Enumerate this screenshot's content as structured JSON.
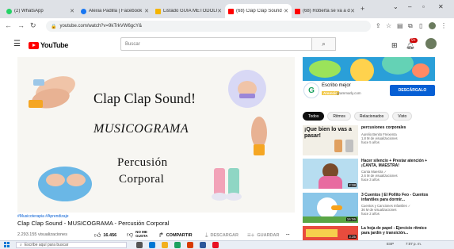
{
  "browser": {
    "tabs": [
      {
        "label": "(2) WhatsApp",
        "color": "#25d366",
        "active": false
      },
      {
        "label": "Alexia Padilla | Facebook",
        "color": "#1877f2",
        "active": false
      },
      {
        "label": "Listado GUIA METODOLÓ...",
        "color": "#f4b400",
        "active": false
      },
      {
        "label": "(68) Clap Clap Sound - Mú...",
        "color": "#ff0000",
        "active": true
      },
      {
        "label": "(68) Roberta se va a dorm...",
        "color": "#ff0000",
        "active": false
      }
    ],
    "new_tab": "+",
    "url": "youtube.com/watch?v=9kTrkVW6gcY&"
  },
  "youtube": {
    "logo_text": "YouTube",
    "search_placeholder": "Buscar",
    "notification_count": "9+"
  },
  "video": {
    "slide": {
      "line1": "Clap Clap Sound!",
      "line2": "MUSICOGRAMA",
      "line3": "Percusión",
      "line4": "Corporal"
    },
    "hashtags": "#Musicoterapia #Aprendizaje",
    "title": "Clap Clap Sound - MUSICOGRAMA - Percusión Corporal",
    "views": "2.293.155 visualizaciones",
    "likes": "16.456",
    "dislike_label": "NO ME GUSTA",
    "share_label": "COMPARTIR",
    "download_label": "DESCARGAR",
    "save_label": "GUARDAR",
    "more_label": "..."
  },
  "sidebar": {
    "ad": {
      "title": "Escribo mejor",
      "badge": "Anuncio",
      "url": "grammarly.com",
      "button": "DESCÁRGALO"
    },
    "chips": [
      {
        "label": "Todos",
        "active": true
      },
      {
        "label": "Ritmos",
        "active": false
      },
      {
        "label": "Relacionados",
        "active": false
      },
      {
        "label": "Visto",
        "active": false
      }
    ],
    "recommendations": [
      {
        "title": "percusiones corporales",
        "thumb_text": "¡Que bien lo vas a pasar!",
        "channel": "Aurelio Benito Freixenta",
        "views": "1,8 M de visualizaciones",
        "age": "hace 5 años",
        "duration": ""
      },
      {
        "title": "Hacer silencio + Prestar atención + ¡CANTA, MAESTRA!",
        "channel": "Canta Maestra ✓",
        "views": "2,6 M de visualizaciones",
        "age": "hace 3 años",
        "duration": "2:38"
      },
      {
        "title": "3 Cuentos | El Pollito Feo - Cuentos infantiles para dormir...",
        "channel": "Cuentos y Canciones Infantiles ✓",
        "views": "36 M de visualizaciones",
        "age": "hace 2 años",
        "duration": "16:06"
      },
      {
        "title": "La hoja de papel - Ejercicio rítmico para jardín y transición...",
        "channel": "",
        "views": "",
        "age": "",
        "duration": "3:35"
      }
    ]
  },
  "taskbar": {
    "search_placeholder": "Escribe aquí para buscar",
    "tray_text": "ESP",
    "clock": "7:07 p. m."
  }
}
